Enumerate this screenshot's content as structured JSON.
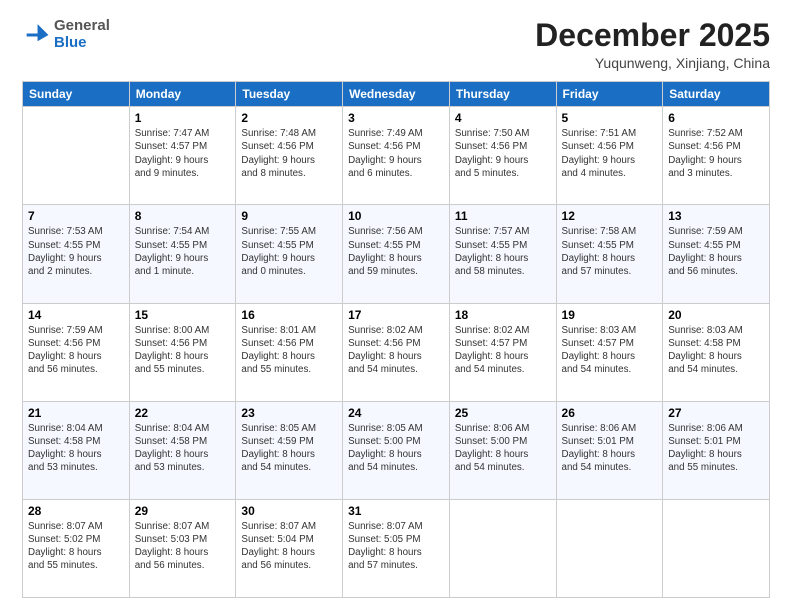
{
  "header": {
    "logo_general": "General",
    "logo_blue": "Blue",
    "month_title": "December 2025",
    "location": "Yuqunweng, Xinjiang, China"
  },
  "days_of_week": [
    "Sunday",
    "Monday",
    "Tuesday",
    "Wednesday",
    "Thursday",
    "Friday",
    "Saturday"
  ],
  "weeks": [
    [
      {
        "day": "",
        "info": ""
      },
      {
        "day": "1",
        "info": "Sunrise: 7:47 AM\nSunset: 4:57 PM\nDaylight: 9 hours\nand 9 minutes."
      },
      {
        "day": "2",
        "info": "Sunrise: 7:48 AM\nSunset: 4:56 PM\nDaylight: 9 hours\nand 8 minutes."
      },
      {
        "day": "3",
        "info": "Sunrise: 7:49 AM\nSunset: 4:56 PM\nDaylight: 9 hours\nand 6 minutes."
      },
      {
        "day": "4",
        "info": "Sunrise: 7:50 AM\nSunset: 4:56 PM\nDaylight: 9 hours\nand 5 minutes."
      },
      {
        "day": "5",
        "info": "Sunrise: 7:51 AM\nSunset: 4:56 PM\nDaylight: 9 hours\nand 4 minutes."
      },
      {
        "day": "6",
        "info": "Sunrise: 7:52 AM\nSunset: 4:56 PM\nDaylight: 9 hours\nand 3 minutes."
      }
    ],
    [
      {
        "day": "7",
        "info": "Sunrise: 7:53 AM\nSunset: 4:55 PM\nDaylight: 9 hours\nand 2 minutes."
      },
      {
        "day": "8",
        "info": "Sunrise: 7:54 AM\nSunset: 4:55 PM\nDaylight: 9 hours\nand 1 minute."
      },
      {
        "day": "9",
        "info": "Sunrise: 7:55 AM\nSunset: 4:55 PM\nDaylight: 9 hours\nand 0 minutes."
      },
      {
        "day": "10",
        "info": "Sunrise: 7:56 AM\nSunset: 4:55 PM\nDaylight: 8 hours\nand 59 minutes."
      },
      {
        "day": "11",
        "info": "Sunrise: 7:57 AM\nSunset: 4:55 PM\nDaylight: 8 hours\nand 58 minutes."
      },
      {
        "day": "12",
        "info": "Sunrise: 7:58 AM\nSunset: 4:55 PM\nDaylight: 8 hours\nand 57 minutes."
      },
      {
        "day": "13",
        "info": "Sunrise: 7:59 AM\nSunset: 4:55 PM\nDaylight: 8 hours\nand 56 minutes."
      }
    ],
    [
      {
        "day": "14",
        "info": "Sunrise: 7:59 AM\nSunset: 4:56 PM\nDaylight: 8 hours\nand 56 minutes."
      },
      {
        "day": "15",
        "info": "Sunrise: 8:00 AM\nSunset: 4:56 PM\nDaylight: 8 hours\nand 55 minutes."
      },
      {
        "day": "16",
        "info": "Sunrise: 8:01 AM\nSunset: 4:56 PM\nDaylight: 8 hours\nand 55 minutes."
      },
      {
        "day": "17",
        "info": "Sunrise: 8:02 AM\nSunset: 4:56 PM\nDaylight: 8 hours\nand 54 minutes."
      },
      {
        "day": "18",
        "info": "Sunrise: 8:02 AM\nSunset: 4:57 PM\nDaylight: 8 hours\nand 54 minutes."
      },
      {
        "day": "19",
        "info": "Sunrise: 8:03 AM\nSunset: 4:57 PM\nDaylight: 8 hours\nand 54 minutes."
      },
      {
        "day": "20",
        "info": "Sunrise: 8:03 AM\nSunset: 4:58 PM\nDaylight: 8 hours\nand 54 minutes."
      }
    ],
    [
      {
        "day": "21",
        "info": "Sunrise: 8:04 AM\nSunset: 4:58 PM\nDaylight: 8 hours\nand 53 minutes."
      },
      {
        "day": "22",
        "info": "Sunrise: 8:04 AM\nSunset: 4:58 PM\nDaylight: 8 hours\nand 53 minutes."
      },
      {
        "day": "23",
        "info": "Sunrise: 8:05 AM\nSunset: 4:59 PM\nDaylight: 8 hours\nand 54 minutes."
      },
      {
        "day": "24",
        "info": "Sunrise: 8:05 AM\nSunset: 5:00 PM\nDaylight: 8 hours\nand 54 minutes."
      },
      {
        "day": "25",
        "info": "Sunrise: 8:06 AM\nSunset: 5:00 PM\nDaylight: 8 hours\nand 54 minutes."
      },
      {
        "day": "26",
        "info": "Sunrise: 8:06 AM\nSunset: 5:01 PM\nDaylight: 8 hours\nand 54 minutes."
      },
      {
        "day": "27",
        "info": "Sunrise: 8:06 AM\nSunset: 5:01 PM\nDaylight: 8 hours\nand 55 minutes."
      }
    ],
    [
      {
        "day": "28",
        "info": "Sunrise: 8:07 AM\nSunset: 5:02 PM\nDaylight: 8 hours\nand 55 minutes."
      },
      {
        "day": "29",
        "info": "Sunrise: 8:07 AM\nSunset: 5:03 PM\nDaylight: 8 hours\nand 56 minutes."
      },
      {
        "day": "30",
        "info": "Sunrise: 8:07 AM\nSunset: 5:04 PM\nDaylight: 8 hours\nand 56 minutes."
      },
      {
        "day": "31",
        "info": "Sunrise: 8:07 AM\nSunset: 5:05 PM\nDaylight: 8 hours\nand 57 minutes."
      },
      {
        "day": "",
        "info": ""
      },
      {
        "day": "",
        "info": ""
      },
      {
        "day": "",
        "info": ""
      }
    ]
  ]
}
